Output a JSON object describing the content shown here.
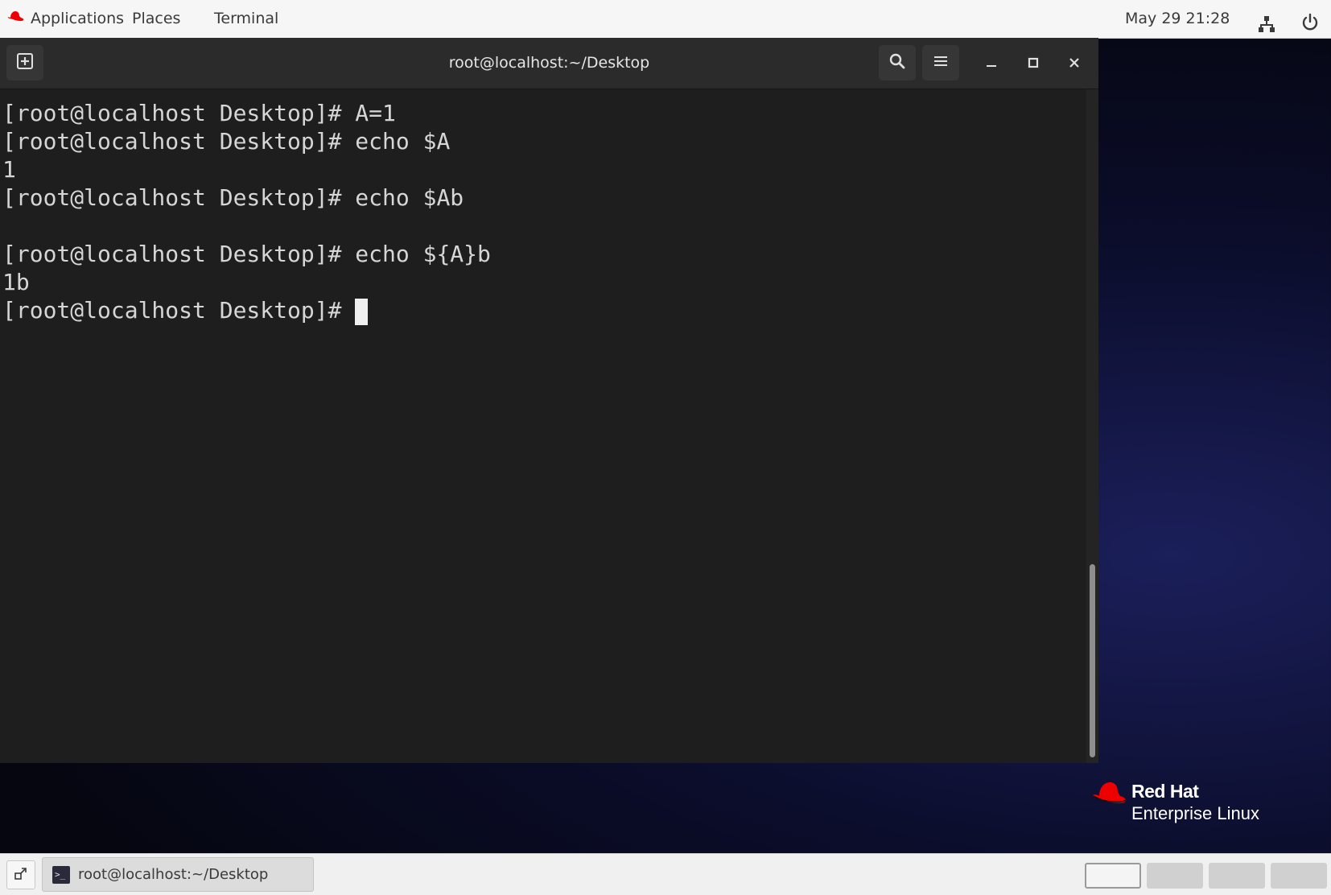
{
  "topbar": {
    "applications_label": "Applications",
    "places_label": "Places",
    "terminal_label": "Terminal",
    "clock": "May 29  21:28",
    "network_icon": "network-icon",
    "power_icon": "power-icon"
  },
  "window": {
    "title": "root@localhost:~/Desktop",
    "new_tab_icon": "new-tab-icon",
    "search_icon": "search-icon",
    "menu_icon": "hamburger-menu-icon"
  },
  "terminal": {
    "lines": [
      "[root@localhost Desktop]# A=1",
      "[root@localhost Desktop]# echo $A",
      "1",
      "[root@localhost Desktop]# echo $Ab",
      "",
      "[root@localhost Desktop]# echo ${A}b",
      "1b"
    ],
    "prompt": "[root@localhost Desktop]# "
  },
  "desktop": {
    "logo_name": "Red Hat",
    "logo_product": "Enterprise Linux",
    "accent_red": "#ee0000"
  },
  "taskbar": {
    "window_item_label": "root@localhost:~/Desktop",
    "workspaces": [
      {
        "active": true
      },
      {
        "active": false
      },
      {
        "active": false
      },
      {
        "active": false
      }
    ]
  }
}
